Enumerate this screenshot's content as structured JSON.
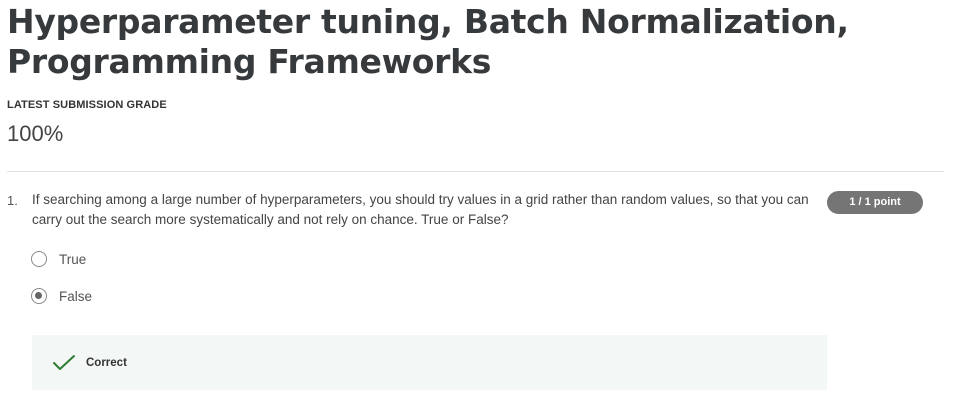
{
  "header": {
    "title": "Hyperparameter tuning, Batch Normalization, Programming Frameworks",
    "grade_label": "LATEST SUBMISSION GRADE",
    "grade_value": "100%"
  },
  "question": {
    "number": "1.",
    "text": "If searching among a large number of hyperparameters, you should try values in a grid rather than random values, so that you can carry out the search more systematically and not rely on chance. True or False?",
    "points": "1 / 1 point",
    "options": [
      {
        "label": "True",
        "selected": false
      },
      {
        "label": "False",
        "selected": true
      }
    ],
    "feedback": {
      "status": "Correct",
      "icon": "checkmark-icon",
      "color": "#2e7d32"
    }
  },
  "colors": {
    "badge_bg": "#757575",
    "feedback_bg": "#f3f7f5",
    "title": "#373a3c"
  }
}
